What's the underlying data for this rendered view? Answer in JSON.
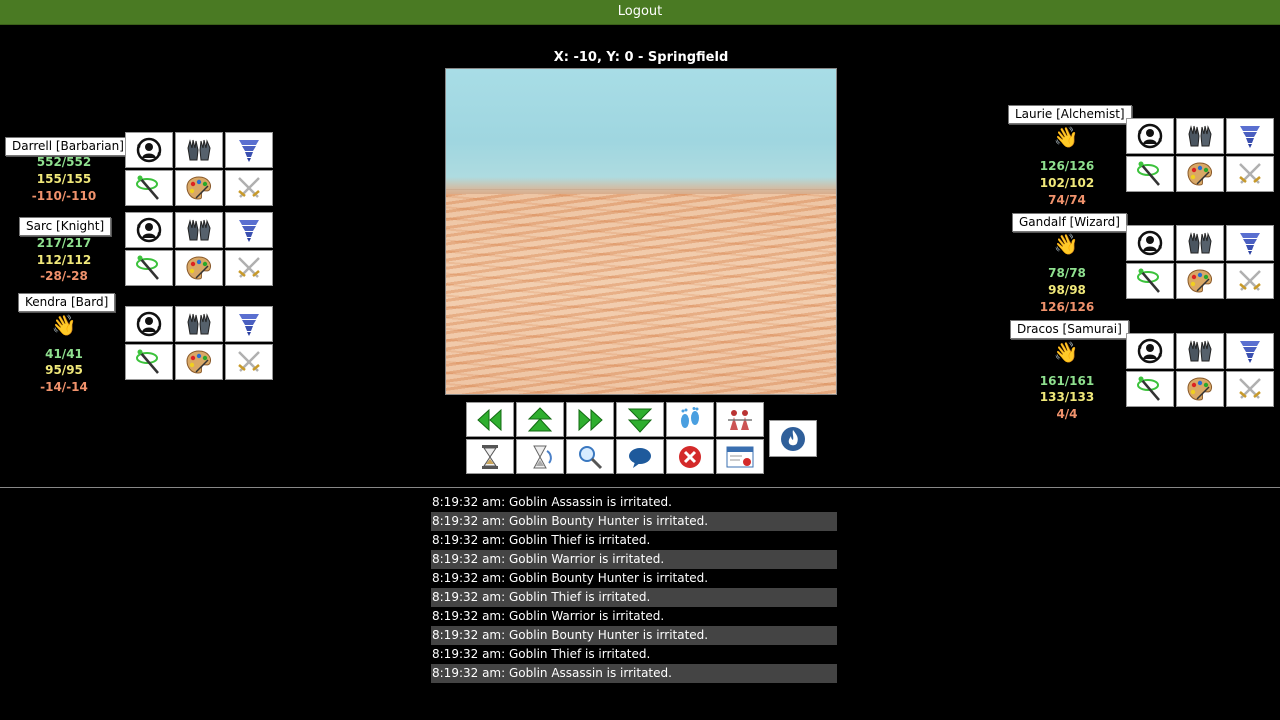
{
  "header": {
    "logout_label": "Logout"
  },
  "location": {
    "text": "X: -10, Y: 0 - Springfield"
  },
  "party_left": [
    {
      "name": "Darrell [Barbarian]",
      "hp": "552/552",
      "mp": "155/155",
      "xp": "-110/-110",
      "hand": false
    },
    {
      "name": "Sarc [Knight]",
      "hp": "217/217",
      "mp": "112/112",
      "xp": "-28/-28",
      "hand": false
    },
    {
      "name": "Kendra [Bard]",
      "hp": "41/41",
      "mp": "95/95",
      "xp": "-14/-14",
      "hand": true
    }
  ],
  "party_right": [
    {
      "name": "Laurie [Alchemist]",
      "hp": "126/126",
      "mp": "102/102",
      "xp": "74/74",
      "hand": true
    },
    {
      "name": "Gandalf [Wizard]",
      "hp": "78/78",
      "mp": "98/98",
      "xp": "126/126",
      "hand": true
    },
    {
      "name": "Dracos [Samurai]",
      "hp": "161/161",
      "mp": "133/133",
      "xp": "4/4",
      "hand": true
    }
  ],
  "action_icons": [
    "swap-character-icon",
    "gloves-icon",
    "tornado-icon",
    "staff-spell-icon",
    "palette-icon",
    "crossed-swords-icon"
  ],
  "controls": [
    "arrow-left-icon",
    "arrow-up-icon",
    "arrow-right-icon",
    "arrow-down-icon",
    "footprints-icon",
    "party-icon",
    "hourglass-icon",
    "hourglass-refresh-icon",
    "magnifier-icon",
    "chat-bubble-icon",
    "cancel-icon",
    "window-close-icon",
    "fire-icon"
  ],
  "colors": {
    "topbar": "#4a7a23",
    "hp": "#8fe08f",
    "mp": "#f0e87a",
    "xp": "#f0926c"
  },
  "log": [
    "8:19:32 am: Goblin Assassin is irritated.",
    "8:19:32 am: Goblin Bounty Hunter is irritated.",
    "8:19:32 am: Goblin Thief is irritated.",
    "8:19:32 am: Goblin Warrior is irritated.",
    "8:19:32 am: Goblin Bounty Hunter is irritated.",
    "8:19:32 am: Goblin Thief is irritated.",
    "8:19:32 am: Goblin Warrior is irritated.",
    "8:19:32 am: Goblin Bounty Hunter is irritated.",
    "8:19:32 am: Goblin Thief is irritated.",
    "8:19:32 am: Goblin Assassin is irritated."
  ]
}
